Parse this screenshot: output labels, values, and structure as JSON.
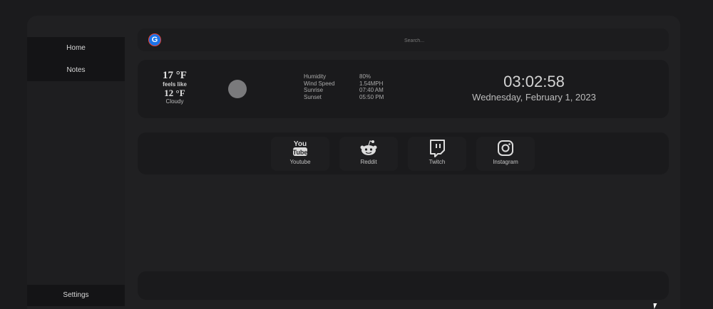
{
  "sidebar": {
    "items": [
      {
        "label": "Home"
      },
      {
        "label": "Notes"
      }
    ],
    "settings_label": "Settings"
  },
  "search": {
    "placeholder": "Search..."
  },
  "weather": {
    "temp": "17 °F",
    "feels_like_label": "feels like",
    "feels_like_temp": "12 °F",
    "condition": "Cloudy",
    "stats": [
      {
        "label": "Humidity",
        "value": "80%"
      },
      {
        "label": "Wind Speed",
        "value": "1.54MPH"
      },
      {
        "label": "Sunrise",
        "value": "07:40 AM"
      },
      {
        "label": "Sunset",
        "value": "05:50 PM"
      }
    ]
  },
  "clock": {
    "time": "03:02:58",
    "date": "Wednesday, February 1, 2023"
  },
  "quick_links": [
    {
      "label": "Youtube",
      "icon": "youtube-icon"
    },
    {
      "label": "Reddit",
      "icon": "reddit-icon"
    },
    {
      "label": "Twitch",
      "icon": "twitch-icon"
    },
    {
      "label": "Instagram",
      "icon": "instagram-icon"
    }
  ],
  "colors": {
    "background": "#1b1b1d",
    "panel": "#1a1a1c",
    "sidebar": "#141416",
    "accent_google": "#1a73e8"
  }
}
